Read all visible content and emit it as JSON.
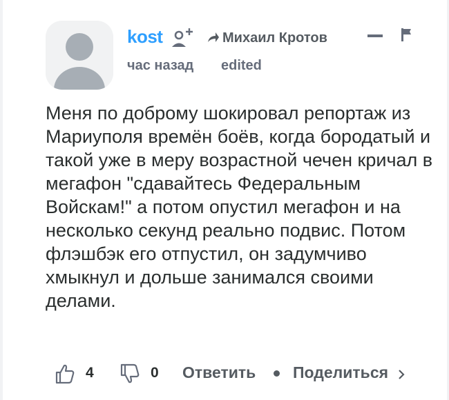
{
  "comment": {
    "author": "kost",
    "reply_to": "Михаил Кротов",
    "time": "час назад",
    "edited": "edited",
    "text": "Меня по доброму шокировал репортаж из Мариуполя времён боёв, когда бородатый и такой уже в меру возрастной чечен кричал в мегафон \"сдавайтесь Федеральным Войскам!\" а потом опустил мегафон и на несколько секунд реально подвис. Потом флэшбэк его отпустил, он задумчиво хмыкнул и дольше занимался своими делами.",
    "upvotes": "4",
    "downvotes": "0",
    "reply_label": "Ответить",
    "share_label": "Поделиться"
  },
  "icons": {
    "avatar": "avatar-placeholder",
    "follow": "follow-user-icon",
    "reply_arrow": "reply-arrow-icon",
    "collapse": "minus-icon",
    "flag": "flag-icon",
    "upvote": "thumbs-up-icon",
    "downvote": "thumbs-down-icon",
    "share_chevron": "chevron-right-icon"
  },
  "colors": {
    "author": "#2e9fff",
    "text": "#2a2e2e",
    "muted": "#656c7a"
  }
}
